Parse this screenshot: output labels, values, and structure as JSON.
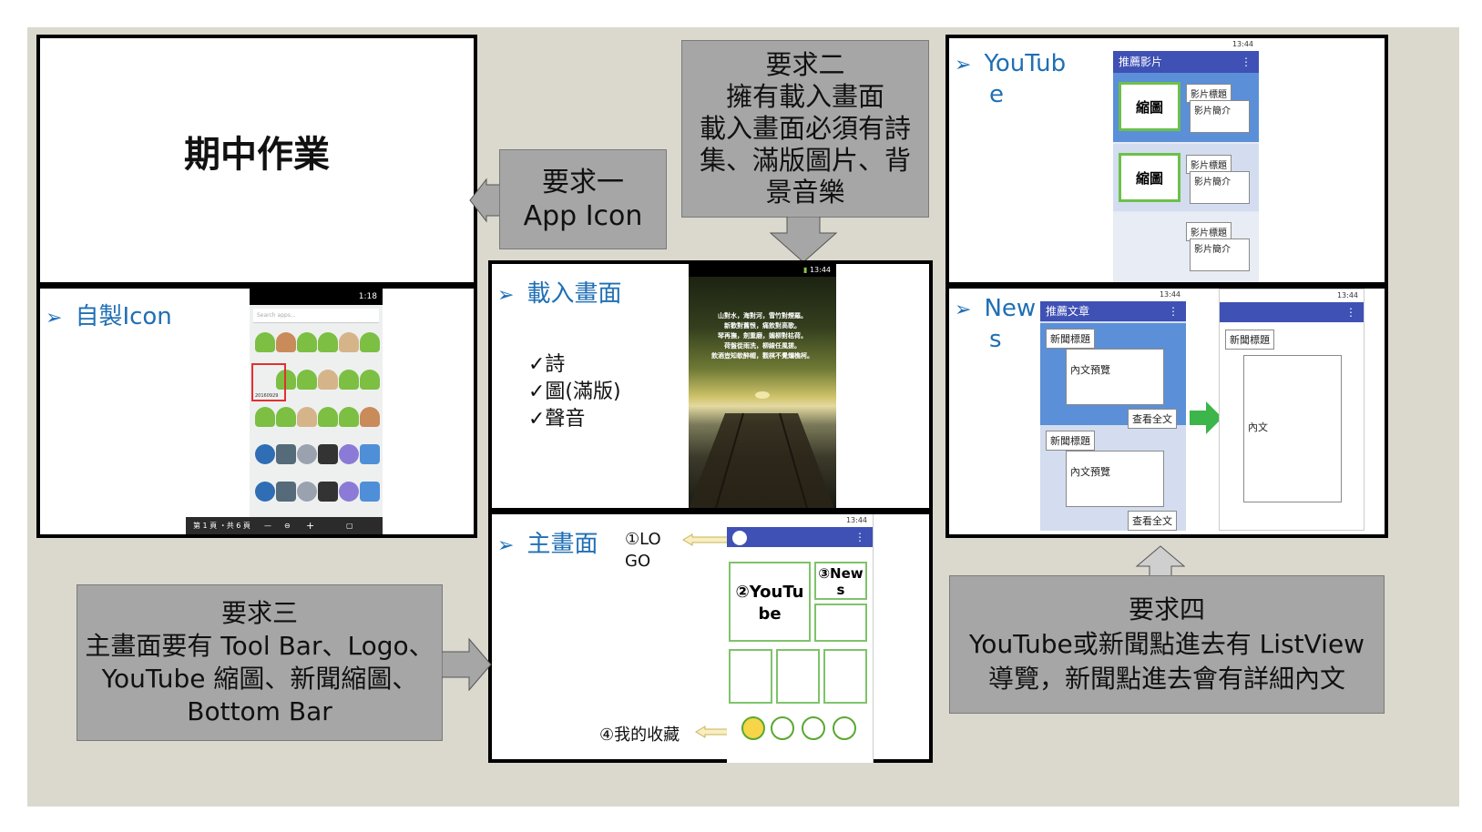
{
  "slide_title": "期中作業",
  "requirements": {
    "req1": {
      "title": "要求一",
      "lines": [
        "App Icon"
      ]
    },
    "req2": {
      "title": "要求二",
      "lines": [
        "擁有載入畫面",
        "載入畫面必須有詩",
        "集、滿版圖片、背",
        "景音樂"
      ]
    },
    "req3": {
      "title": "要求三",
      "lines": [
        "主畫面要有 Tool Bar、Logo、",
        "YouTube 縮圖、新聞縮圖、",
        "Bottom Bar"
      ]
    },
    "req4": {
      "title": "要求四",
      "lines": [
        "YouTube或新聞點進去有 ListView",
        "導覽，新聞點進去會有詳細內文"
      ]
    }
  },
  "icon_panel": {
    "heading": "自製Icon",
    "search_placeholder": "Search apps...",
    "status_time": "1:18",
    "highlight_label": "20160929",
    "footer": "第 1 頁 ・共 6 頁"
  },
  "loading_panel": {
    "heading": "載入畫面",
    "checks": [
      "✓詩",
      "✓圖(滿版)",
      "✓聲音"
    ],
    "status_time": "13:44",
    "poem": [
      "山對水，海對河，雪竹對煙羅。",
      "新歡對舊恨，痛飲對高歌。",
      "琴再撫，劍重磨，媚柳對枯荷。",
      "荷盤從雨洗，柳線任風搓。",
      "飲酒豈知欹醉帽，觀棋不覺爛樵柯。"
    ]
  },
  "main_panel": {
    "heading": "主畫面",
    "logo_label": [
      "①LO",
      "GO"
    ],
    "youtube_label": [
      "②YouTu",
      "be"
    ],
    "news_label": [
      "③New",
      "s"
    ],
    "favorite_label": "④我的收藏",
    "status_time": "13:44"
  },
  "youtube_panel": {
    "heading": [
      "YouTub",
      "e"
    ],
    "toolbar_title": "推薦影片",
    "status_time": "13:44",
    "thumb_label": "縮圖",
    "video_title": "影片標題",
    "video_desc": "影片簡介"
  },
  "news_panel": {
    "heading": [
      "New",
      "s"
    ],
    "toolbar_title": "推薦文章",
    "status_time": "13:44",
    "news_title": "新聞標題",
    "preview": "內文預覽",
    "read_more": "查看全文",
    "detail_text": "內文"
  },
  "menu_dots": "⋮"
}
